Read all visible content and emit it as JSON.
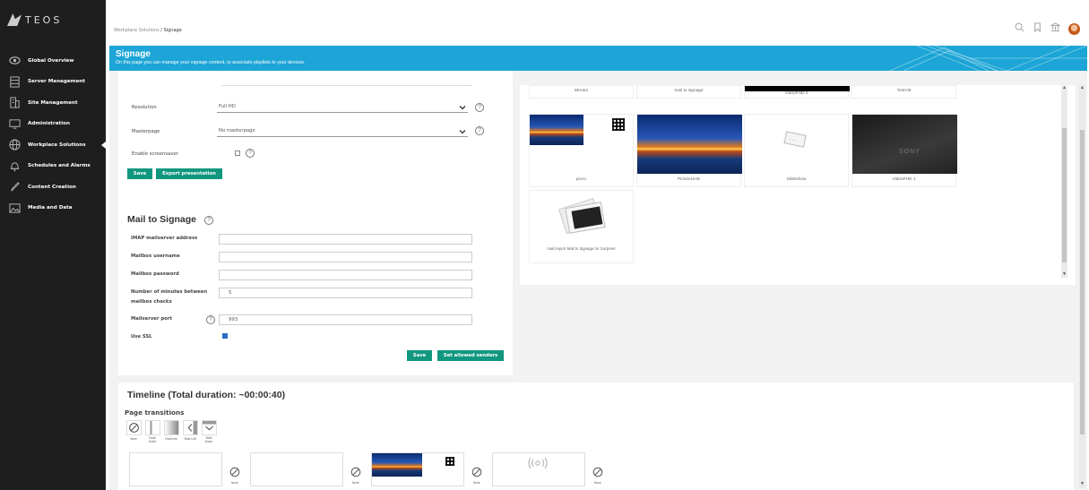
{
  "app": {
    "logo_text": "TEOS"
  },
  "sidebar": {
    "items": [
      {
        "label": "Global Overview",
        "icon": "eye-icon"
      },
      {
        "label": "Server Management",
        "icon": "server-icon"
      },
      {
        "label": "Site Management",
        "icon": "building-icon"
      },
      {
        "label": "Administration",
        "icon": "monitor-icon"
      },
      {
        "label": "Workplace Solutions",
        "icon": "globe-icon"
      },
      {
        "label": "Schedules and Alarms",
        "icon": "bell-icon"
      },
      {
        "label": "Content Creation",
        "icon": "pen-icon"
      },
      {
        "label": "Media and Data",
        "icon": "image-icon"
      }
    ]
  },
  "breadcrumb": {
    "parent": "Workplace Solutions",
    "separator": " / ",
    "current": "Signage"
  },
  "banner": {
    "title": "Signage",
    "subtitle": "On this page you can manage your signage content, to associate playlists to your devices.",
    "color": "#1ca5d6"
  },
  "settings": {
    "resolution_label": "Resolution",
    "resolution_value": "Full HD",
    "masterpage_label": "Masterpage",
    "masterpage_value": "No masterpage",
    "screensaver_label": "Enable screensaver",
    "help_glyph": "?",
    "save_label": "Save",
    "export_label": "Export presentation"
  },
  "mail": {
    "title": "Mail to Signage",
    "imap_label": "IMAP mailserver address",
    "imap_value": "",
    "username_label": "Mailbox username",
    "username_value": "",
    "password_label": "Mailbox password",
    "password_value": "",
    "minutes_label_1": "Number of minutes between",
    "minutes_label_2": "mailbox checks",
    "minutes_value": "5",
    "port_label": "Mailserver port",
    "port_value": "993",
    "ssl_label": "Use SSL",
    "save_label": "Save",
    "senders_label": "Set allowed senders"
  },
  "media": {
    "row1": [
      "Stream",
      "mail to signage",
      "VideoFHD 2",
      "TestVid"
    ],
    "row2": [
      "picco",
      "PictureUHD",
      "Slideshow",
      "VideoFHD 1"
    ],
    "row3": [
      "mail import Mail to Signage for Gurpreet"
    ],
    "tv_brand": "SONY"
  },
  "timeline": {
    "title": "Timeline (Total duration: ~00:00:40)",
    "transitions_title": "Page transitions",
    "transitions": [
      {
        "l1": "None",
        "l2": ""
      },
      {
        "l1": "Fade",
        "l2": "Out/In"
      },
      {
        "l1": "Fade into",
        "l2": ""
      },
      {
        "l1": "Slide Left",
        "l2": ""
      },
      {
        "l1": "Slide",
        "l2": "Down"
      }
    ],
    "none_label": "None",
    "accent": "#11977f"
  }
}
